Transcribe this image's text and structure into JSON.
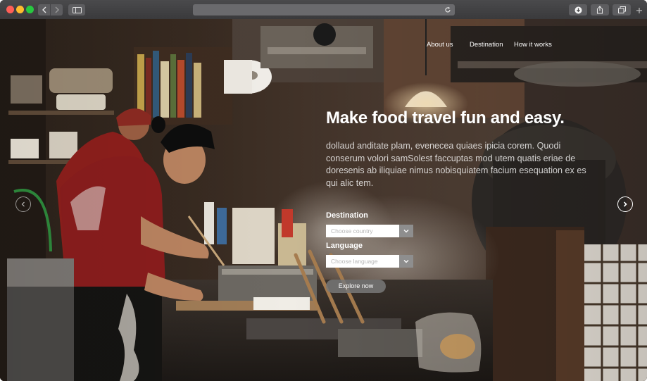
{
  "browser": {
    "url_text": "",
    "icons": [
      "back-icon",
      "forward-icon",
      "sidebar-icon",
      "reload-icon",
      "download-icon",
      "share-icon",
      "tabs-icon",
      "new-tab-icon"
    ]
  },
  "nav": {
    "about": "About us",
    "destination": "Destination",
    "how_it_works": "How it works"
  },
  "hero": {
    "headline": "Make food travel fun and easy.",
    "body": "dollaud anditate plam, evenecea quiaes ipicia corem. Quodi conserum volori samSolest faccuptas mod utem quatis eriae de doresenis ab iliquiae nimus nobisquiatem facium esequation ex es qui alic tem."
  },
  "form": {
    "destination_label": "Destination",
    "destination_placeholder": "Choose country",
    "language_label": "Language",
    "language_placeholder": "Choose language",
    "explore_button": "Explore now"
  },
  "carousel": {
    "prev_symbol": "<",
    "next_symbol": ">"
  },
  "colors": {
    "toolbar": "#3f3f41",
    "close": "#ff5f57",
    "minimize": "#febc2e",
    "zoom": "#28c840",
    "select_caret_bg": "#8e8e8e",
    "button_bg": "#787878"
  }
}
